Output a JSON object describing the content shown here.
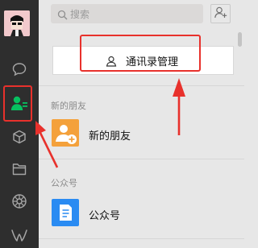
{
  "search": {
    "placeholder": "搜索"
  },
  "contacts_manage": {
    "label": "通讯录管理"
  },
  "sections": {
    "new_friends": {
      "header": "新的朋友",
      "item_label": "新的朋友"
    },
    "official_accounts": {
      "header": "公众号",
      "item_label": "公众号"
    }
  },
  "sidebar": {
    "items": [
      "chat-icon",
      "contacts-icon",
      "mini-programs-icon",
      "files-icon",
      "moments-icon",
      "wechat-logo-icon"
    ],
    "active": "contacts-icon"
  },
  "colors": {
    "sidebar_bg": "#2e2e2e",
    "active_green": "#07c160",
    "highlight_red": "#e8312c",
    "new_friends_orange": "#f4a13b",
    "official_blue": "#2a8bf2"
  }
}
